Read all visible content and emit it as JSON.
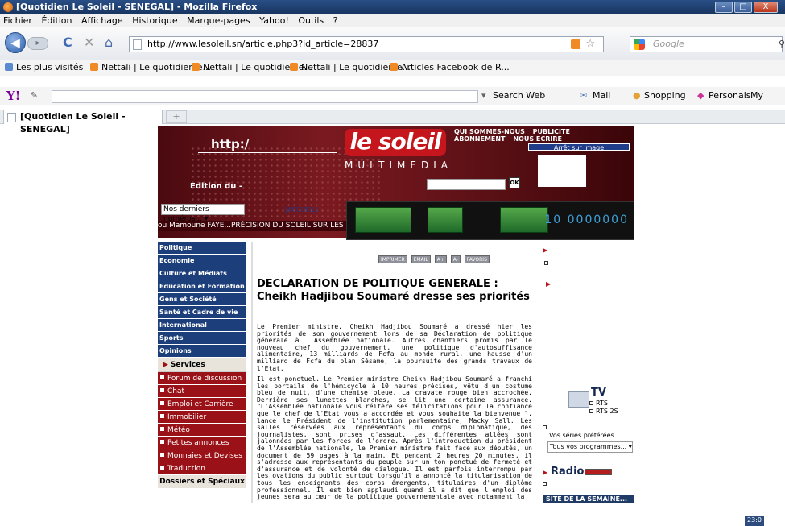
{
  "window": {
    "title": "[Quotidien Le Soleil - SENEGAL] - Mozilla Firefox",
    "minimize": "–",
    "maximize": "□",
    "close": "X"
  },
  "menu": [
    "Fichier",
    "Édition",
    "Affichage",
    "Historique",
    "Marque-pages",
    "Yahoo!",
    "Outils",
    "?"
  ],
  "nav": {
    "back": "◀",
    "forward": "▸",
    "reload": "C",
    "stop": "✕",
    "home": "⌂",
    "url": "http://www.lesoleil.sn/article.php3?id_article=28837",
    "search_placeholder": "Google"
  },
  "bookmarks": [
    "Les plus visités",
    "Nettali | Le quotidien e...",
    "Nettali | Le quotidien e...",
    "Nettali | Le quotidien e...",
    "Articles Facebook de R..."
  ],
  "yahoo_toolbar": {
    "logo": "Y!",
    "search_web": "Search Web",
    "mail": "Mail",
    "shopping": "Shopping",
    "personals": "Personals",
    "my_yahoo": "My Yahoo!"
  },
  "tab": {
    "label": "[Quotidien Le Soleil - SENEGAL]",
    "new_tab": "+"
  },
  "site": {
    "http_label": "http:/",
    "logo": "le soleil",
    "multimedia": "MULTIMEDIA",
    "edition": "Edition du -",
    "top_nav": [
      "QUI SOMMES-NOUS",
      "PUBLICITE",
      "ABONNEMENT",
      "NOUS ECRIRE"
    ],
    "arret_image": "Arrêt sur image",
    "ok": "OK",
    "numeros": "Nos derniers numéros...",
    "accueil": "[ACCUEIL]",
    "ticker": "ou Mamoune FAYE...PRÉCISION DU SOLEIL SUR LES FOI",
    "banner_digits": "10 0000000"
  },
  "left_nav": {
    "sections": [
      "Politique",
      "Economie",
      "Culture et Médiats",
      "Education et Formation",
      "Gens et Société",
      "Santé et Cadre de vie",
      "International",
      "Sports",
      "Opinions"
    ],
    "services_title": "Services",
    "services": [
      "Forum de discussion",
      "Chat",
      "Emploi et Carrière",
      "Immobilier",
      "Météo",
      "Petites annonces",
      "Monnaies et Devises",
      "Traduction"
    ],
    "dossiers": "Dossiers et Spéciaux"
  },
  "article": {
    "tools": [
      "IMPRIMER",
      "EMAIL",
      "A+",
      "A-",
      "FAVORIS"
    ],
    "headline": "DECLARATION DE POLITIQUE GENERALE : Cheikh Hadjibou Soumaré dresse ses priorités",
    "para1": "Le Premier ministre, Cheikh Hadjibou Soumaré a dressé hier les priorités de son gouvernement lors de sa Déclaration de politique générale à l'Assemblée nationale. Autres chantiers promis par le nouveau chef du gouvernement, une politique d'autosuffisance alimentaire, 13 milliards de Fcfa au monde rural, une hausse d'un milliard de Fcfa du plan Sésame, la poursuite des grands travaux de l'Etat.",
    "para2": "Il est ponctuel. Le Premier ministre Cheikh Hadjibou Soumaré a franchi les portails de l'hémicycle à 10 heures précises, vêtu d'un costume bleu de nuit, d'une chemise bleue. La cravate rouge bien accrochée. Derrière ses lunettes blanches, se lit une certaine assurance. \"L'Assemblée nationale vous réitère ses félicitations pour la confiance que le chef de l'Etat vous a accordée et vous souhaite la bienvenue \", lance le Président de l'institution parlementaire, Macky Sall. Les salles réservées aux représentants du corps diplomatique, des journalistes, sont prises d'assaut. Les différentes allées sont jalonnées par les forces de l'ordre. Après l'introduction du président de l'Assemblée nationale, le Premier ministre fait face aux députés, un document de 59 pages à la main. Et pendant 2 heures 20 minutes, il s'adresse aux représentants du peuple sur un ton ponctué de fermeté et d'assurance et de volonté de dialogue. Il est parfois interrompu par les ovations du public surtout lorsqu'il a annoncé la titularisation de tous les enseignants des corps émergents, titulaires d'un diplôme professionnel. Il est bien applaudi quand il a dit que l'emploi des jeunes sera au cœur de la politique gouvernementale avec notamment la"
  },
  "right_col": {
    "tv_title": "TV",
    "tv_items": [
      "RTS",
      "RTS 2S"
    ],
    "series": "Vos séries préférées",
    "programmes": "Tous vos programmes...",
    "radio": "Radio",
    "semaine": "SITE DE LA SEMAINE..."
  },
  "tray": {
    "time": "23:0"
  }
}
